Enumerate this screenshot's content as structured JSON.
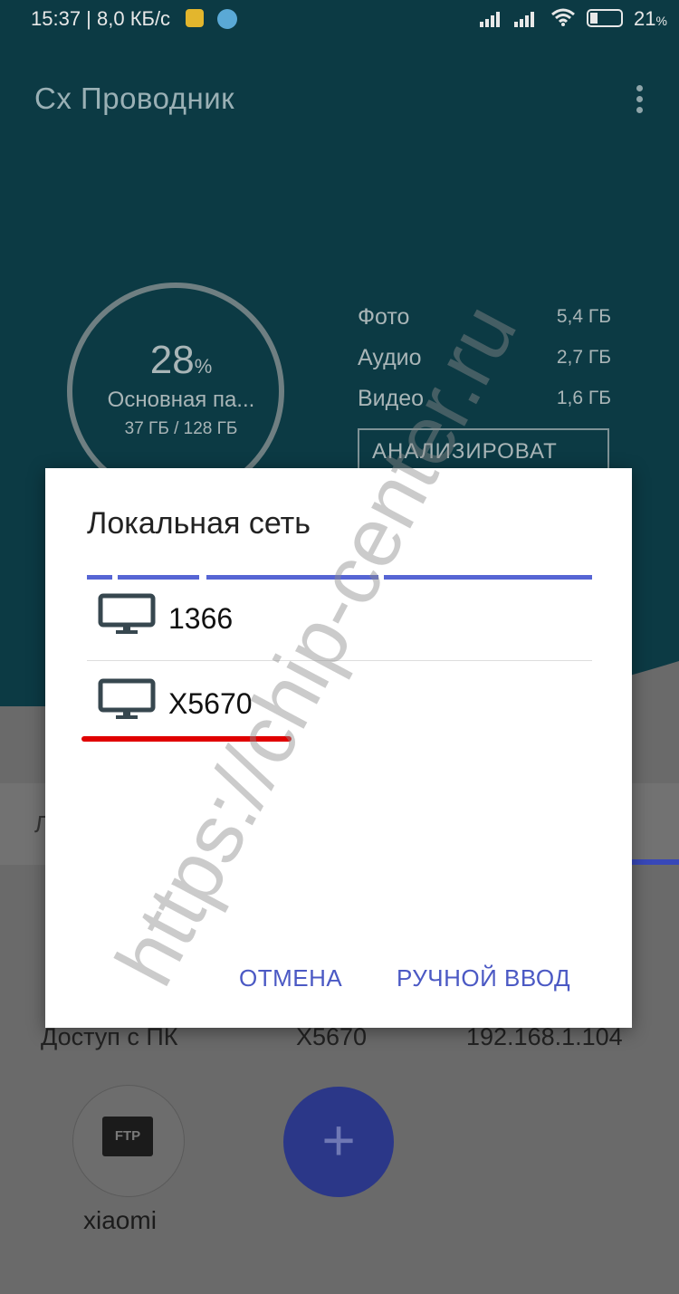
{
  "status_bar": {
    "time_speed": "15:37 | 8,0 КБ/с",
    "battery_pct": "21",
    "battery_unit": "%"
  },
  "app_bar": {
    "title": "Cx Проводник"
  },
  "storage": {
    "percent": "28",
    "percent_unit": "%",
    "label": "Основная па...",
    "usage": "37 ГБ / 128 ГБ",
    "stats": [
      {
        "label": "Фото",
        "value": "5,4 ГБ"
      },
      {
        "label": "Аудио",
        "value": "2,7 ГБ"
      },
      {
        "label": "Видео",
        "value": "1,6 ГБ"
      }
    ],
    "analyze_label": "АНАЛИЗИРОВАТ"
  },
  "background": {
    "strip_letter": "Л",
    "pc_access": {
      "label": "Доступ с ПК",
      "device": "X5670",
      "ip": "192.168.1.104"
    },
    "ftp": {
      "icon_text": "FTP",
      "name": "xiaomi"
    },
    "fab_symbol": "+"
  },
  "dialog": {
    "title": "Локальная сеть",
    "items": [
      {
        "name": "1366"
      },
      {
        "name": "X5670"
      }
    ],
    "cancel_label": "ОТМЕНА",
    "manual_label": "РУЧНОЙ ВВОД"
  },
  "watermark": "https://chip-center.ru",
  "colors": {
    "accent": "#4b59c4",
    "progress": "#5665d4",
    "header_bg": "#0c3a44",
    "highlight": "#e00000"
  }
}
